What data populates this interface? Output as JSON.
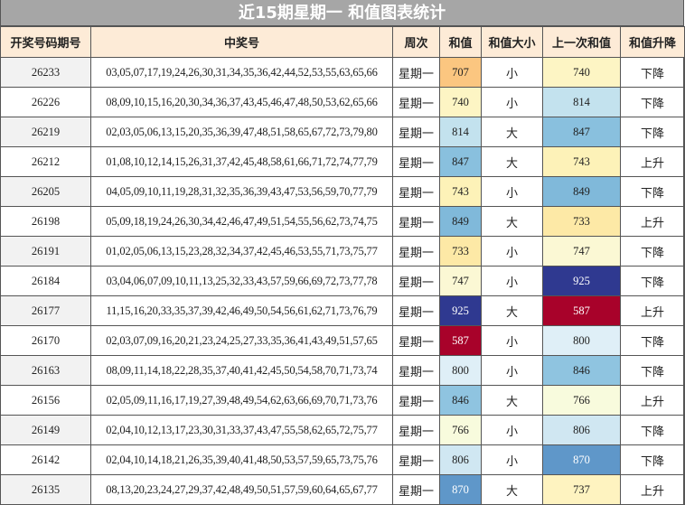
{
  "title": "近15期星期一 和值图表统计",
  "headers": [
    "开奖号码期号",
    "中奖号",
    "周次",
    "和值",
    "和值大小",
    "上一次和值",
    "和值升降"
  ],
  "sum_colors": {
    "707": "#fbc680",
    "733": "#fde9a6",
    "737": "#fef3c0",
    "740": "#fdf5c4",
    "743": "#fdf2b8",
    "747": "#fbf8d4",
    "766": "#f8fbdd",
    "587": "#a8022a",
    "800": "#dfeff7",
    "806": "#d0e7f2",
    "814": "#c3e2ee",
    "846": "#8fc4e0",
    "847": "#89c0de",
    "849": "#80b9da",
    "870": "#5f97c9",
    "925": "#2f3990"
  },
  "dark_text_threshold_values": [
    "587",
    "870",
    "925"
  ],
  "rows": [
    {
      "issue": "26233",
      "numbers": "03,05,07,17,19,24,26,30,31,34,35,36,42,44,52,53,55,63,65,66",
      "weekday": "星期一",
      "sum": "707",
      "size": "小",
      "prev_sum": "740",
      "trend": "下降"
    },
    {
      "issue": "26226",
      "numbers": "08,09,10,15,16,20,30,34,36,37,43,45,46,47,48,50,53,62,65,66",
      "weekday": "星期一",
      "sum": "740",
      "size": "小",
      "prev_sum": "814",
      "trend": "下降"
    },
    {
      "issue": "26219",
      "numbers": "02,03,05,06,13,15,20,35,36,39,47,48,51,58,65,67,72,73,79,80",
      "weekday": "星期一",
      "sum": "814",
      "size": "大",
      "prev_sum": "847",
      "trend": "下降"
    },
    {
      "issue": "26212",
      "numbers": "01,08,10,12,14,15,26,31,37,42,45,48,58,61,66,71,72,74,77,79",
      "weekday": "星期一",
      "sum": "847",
      "size": "大",
      "prev_sum": "743",
      "trend": "上升"
    },
    {
      "issue": "26205",
      "numbers": "04,05,09,10,11,19,28,31,32,35,36,39,43,47,53,56,59,70,77,79",
      "weekday": "星期一",
      "sum": "743",
      "size": "小",
      "prev_sum": "849",
      "trend": "下降"
    },
    {
      "issue": "26198",
      "numbers": "05,09,18,19,24,26,30,34,42,46,47,49,51,54,55,56,62,73,74,75",
      "weekday": "星期一",
      "sum": "849",
      "size": "大",
      "prev_sum": "733",
      "trend": "上升"
    },
    {
      "issue": "26191",
      "numbers": "01,02,05,06,13,15,23,28,32,34,37,42,45,46,53,55,71,73,75,77",
      "weekday": "星期一",
      "sum": "733",
      "size": "小",
      "prev_sum": "747",
      "trend": "下降"
    },
    {
      "issue": "26184",
      "numbers": "03,04,06,07,09,10,11,13,25,32,33,43,57,59,66,69,72,73,77,78",
      "weekday": "星期一",
      "sum": "747",
      "size": "小",
      "prev_sum": "925",
      "trend": "下降"
    },
    {
      "issue": "26177",
      "numbers": "11,15,16,20,33,35,37,39,42,46,49,50,54,56,61,62,71,73,76,79",
      "weekday": "星期一",
      "sum": "925",
      "size": "大",
      "prev_sum": "587",
      "trend": "上升"
    },
    {
      "issue": "26170",
      "numbers": "02,03,07,09,16,20,21,23,24,25,27,33,35,36,41,43,49,51,57,65",
      "weekday": "星期一",
      "sum": "587",
      "size": "小",
      "prev_sum": "800",
      "trend": "下降"
    },
    {
      "issue": "26163",
      "numbers": "08,09,11,14,18,22,28,35,37,40,41,42,45,50,54,58,70,71,73,74",
      "weekday": "星期一",
      "sum": "800",
      "size": "小",
      "prev_sum": "846",
      "trend": "下降"
    },
    {
      "issue": "26156",
      "numbers": "02,05,09,11,16,17,19,27,39,48,49,54,62,63,66,69,70,71,73,76",
      "weekday": "星期一",
      "sum": "846",
      "size": "大",
      "prev_sum": "766",
      "trend": "上升"
    },
    {
      "issue": "26149",
      "numbers": "02,04,10,12,13,17,23,30,31,33,37,43,47,55,58,62,65,72,75,77",
      "weekday": "星期一",
      "sum": "766",
      "size": "小",
      "prev_sum": "806",
      "trend": "下降"
    },
    {
      "issue": "26142",
      "numbers": "02,04,10,14,18,21,26,35,39,40,41,48,50,53,57,59,65,73,75,76",
      "weekday": "星期一",
      "sum": "806",
      "size": "小",
      "prev_sum": "870",
      "trend": "下降"
    },
    {
      "issue": "26135",
      "numbers": "08,13,20,23,24,27,29,37,42,48,49,50,51,57,59,60,64,65,67,77",
      "weekday": "星期一",
      "sum": "870",
      "size": "大",
      "prev_sum": "737",
      "trend": "上升"
    }
  ]
}
